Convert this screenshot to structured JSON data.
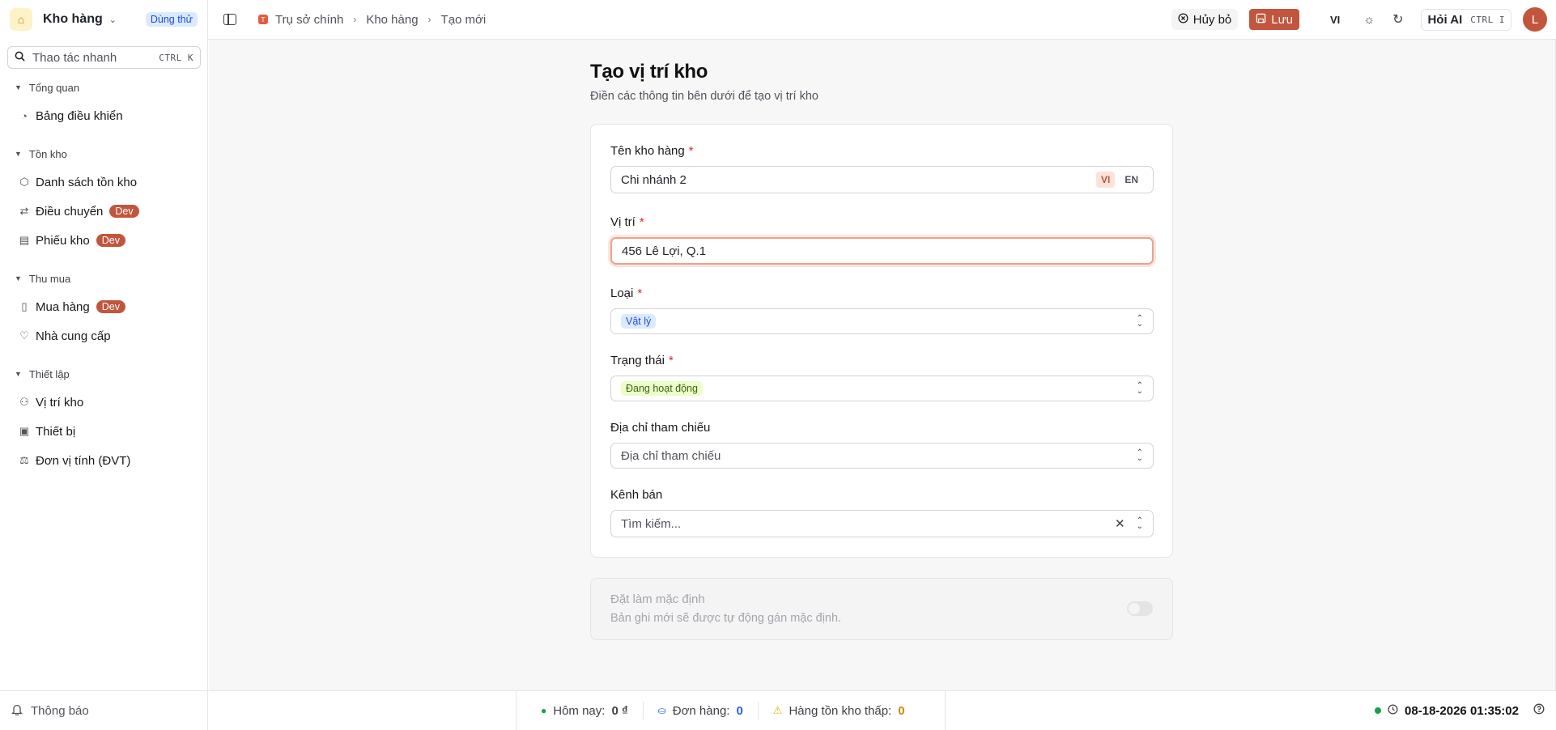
{
  "sidebar": {
    "brand": "Kho hàng",
    "trial_badge": "Dùng thử",
    "quick_action": {
      "placeholder": "Thao tác nhanh",
      "shortcut": "CTRL K"
    },
    "groups": [
      {
        "title": "Tổng quan",
        "items": [
          {
            "label": "Bảng điều khiển"
          }
        ]
      },
      {
        "title": "Tồn kho",
        "items": [
          {
            "label": "Danh sách tồn kho"
          },
          {
            "label": "Điều chuyển",
            "badge": "Dev"
          },
          {
            "label": "Phiếu kho",
            "badge": "Dev"
          }
        ]
      },
      {
        "title": "Thu mua",
        "items": [
          {
            "label": "Mua hàng",
            "badge": "Dev"
          },
          {
            "label": "Nhà cung cấp"
          }
        ]
      },
      {
        "title": "Thiết lập",
        "items": [
          {
            "label": "Vị trí kho"
          },
          {
            "label": "Thiết bị"
          },
          {
            "label": "Đơn vị tính (ĐVT)"
          }
        ]
      }
    ]
  },
  "topbar": {
    "org_initial": "T",
    "breadcrumb": [
      "Trụ sở chính",
      "Kho hàng",
      "Tạo mới"
    ],
    "cancel": "Hủy bỏ",
    "save": "Lưu",
    "language": "VI",
    "ask_ai": "Hỏi AI",
    "ask_ai_shortcut": "CTRL I",
    "avatar_initial": "L"
  },
  "page": {
    "title": "Tạo vị trí kho",
    "subtitle": "Điền các thông tin bên dưới để tạo vị trí kho"
  },
  "form": {
    "name": {
      "label": "Tên kho hàng",
      "value": "Chi nhánh 2",
      "lang_vi": "VI",
      "lang_en": "EN"
    },
    "location": {
      "label": "Vị trí",
      "value": "456 Lê Lợi, Q.1"
    },
    "type": {
      "label": "Loại",
      "value": "Vật lý"
    },
    "status": {
      "label": "Trạng thái",
      "value": "Đang hoạt động"
    },
    "reference_address": {
      "label": "Địa chỉ tham chiếu",
      "placeholder": "Địa chỉ tham chiếu"
    },
    "sales_channel": {
      "label": "Kênh bán",
      "placeholder": "Tìm kiếm..."
    }
  },
  "default_setting": {
    "title": "Đặt làm mặc định",
    "description": "Bản ghi mới sẽ được tự động gán mặc định."
  },
  "footer": {
    "notifications": "Thông báo",
    "today_label": "Hôm nay:",
    "today_value": "0 ₫",
    "orders_label": "Đơn hàng:",
    "orders_value": "0",
    "low_stock_label": "Hàng tồn kho thấp:",
    "low_stock_value": "0",
    "datetime": "08-18-2026 01:35:02"
  },
  "colors": {
    "accent": "#c2553d",
    "required": "#dc2626",
    "online": "#16a34a"
  }
}
